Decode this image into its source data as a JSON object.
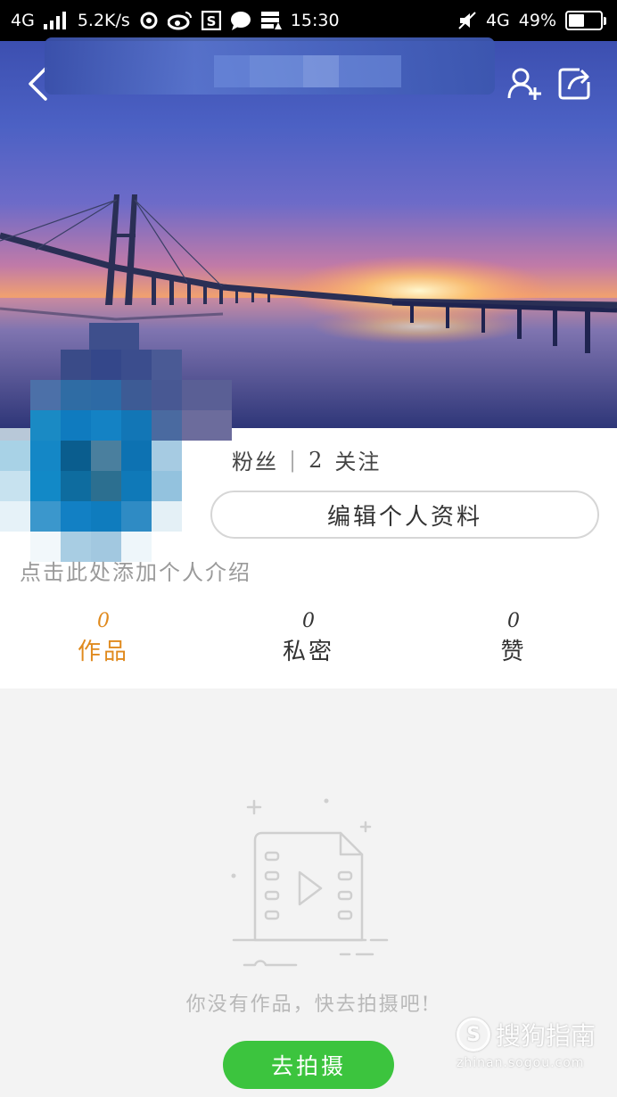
{
  "status_bar": {
    "network_left": "4G",
    "speed": "5.2K/s",
    "time": "15:30",
    "network_right": "4G",
    "battery": "49%",
    "battery_level": 0.49,
    "icons": [
      "signal-icon",
      "weibo-icon",
      "weibo-icon",
      "s-app-icon",
      "chat-icon",
      "notification-icon",
      "mute-icon",
      "battery-icon"
    ]
  },
  "header": {
    "back_icon": "chevron-left-icon",
    "add_friend_icon": "add-user-icon",
    "share_icon": "share-icon"
  },
  "profile": {
    "followers_label": "粉丝",
    "separator": "|",
    "following_count": "2",
    "following_label": "关注",
    "edit_button_label": "编辑个人资料",
    "bio_placeholder": "点击此处添加个人介绍"
  },
  "tabs": [
    {
      "count": "0",
      "label": "作品",
      "active": true
    },
    {
      "count": "0",
      "label": "私密",
      "active": false
    },
    {
      "count": "0",
      "label": "赞",
      "active": false
    }
  ],
  "empty_state": {
    "icon": "video-file-icon",
    "message": "你没有作品，快去拍摄吧!",
    "button_label": "去拍摄"
  },
  "watermark": {
    "logo": "S",
    "name": "搜狗指南",
    "url": "zhinan.sogou.com"
  },
  "colors": {
    "accent": "#e08a1e",
    "button_green": "#3cc43e",
    "muted_text": "#9a9a9a"
  }
}
